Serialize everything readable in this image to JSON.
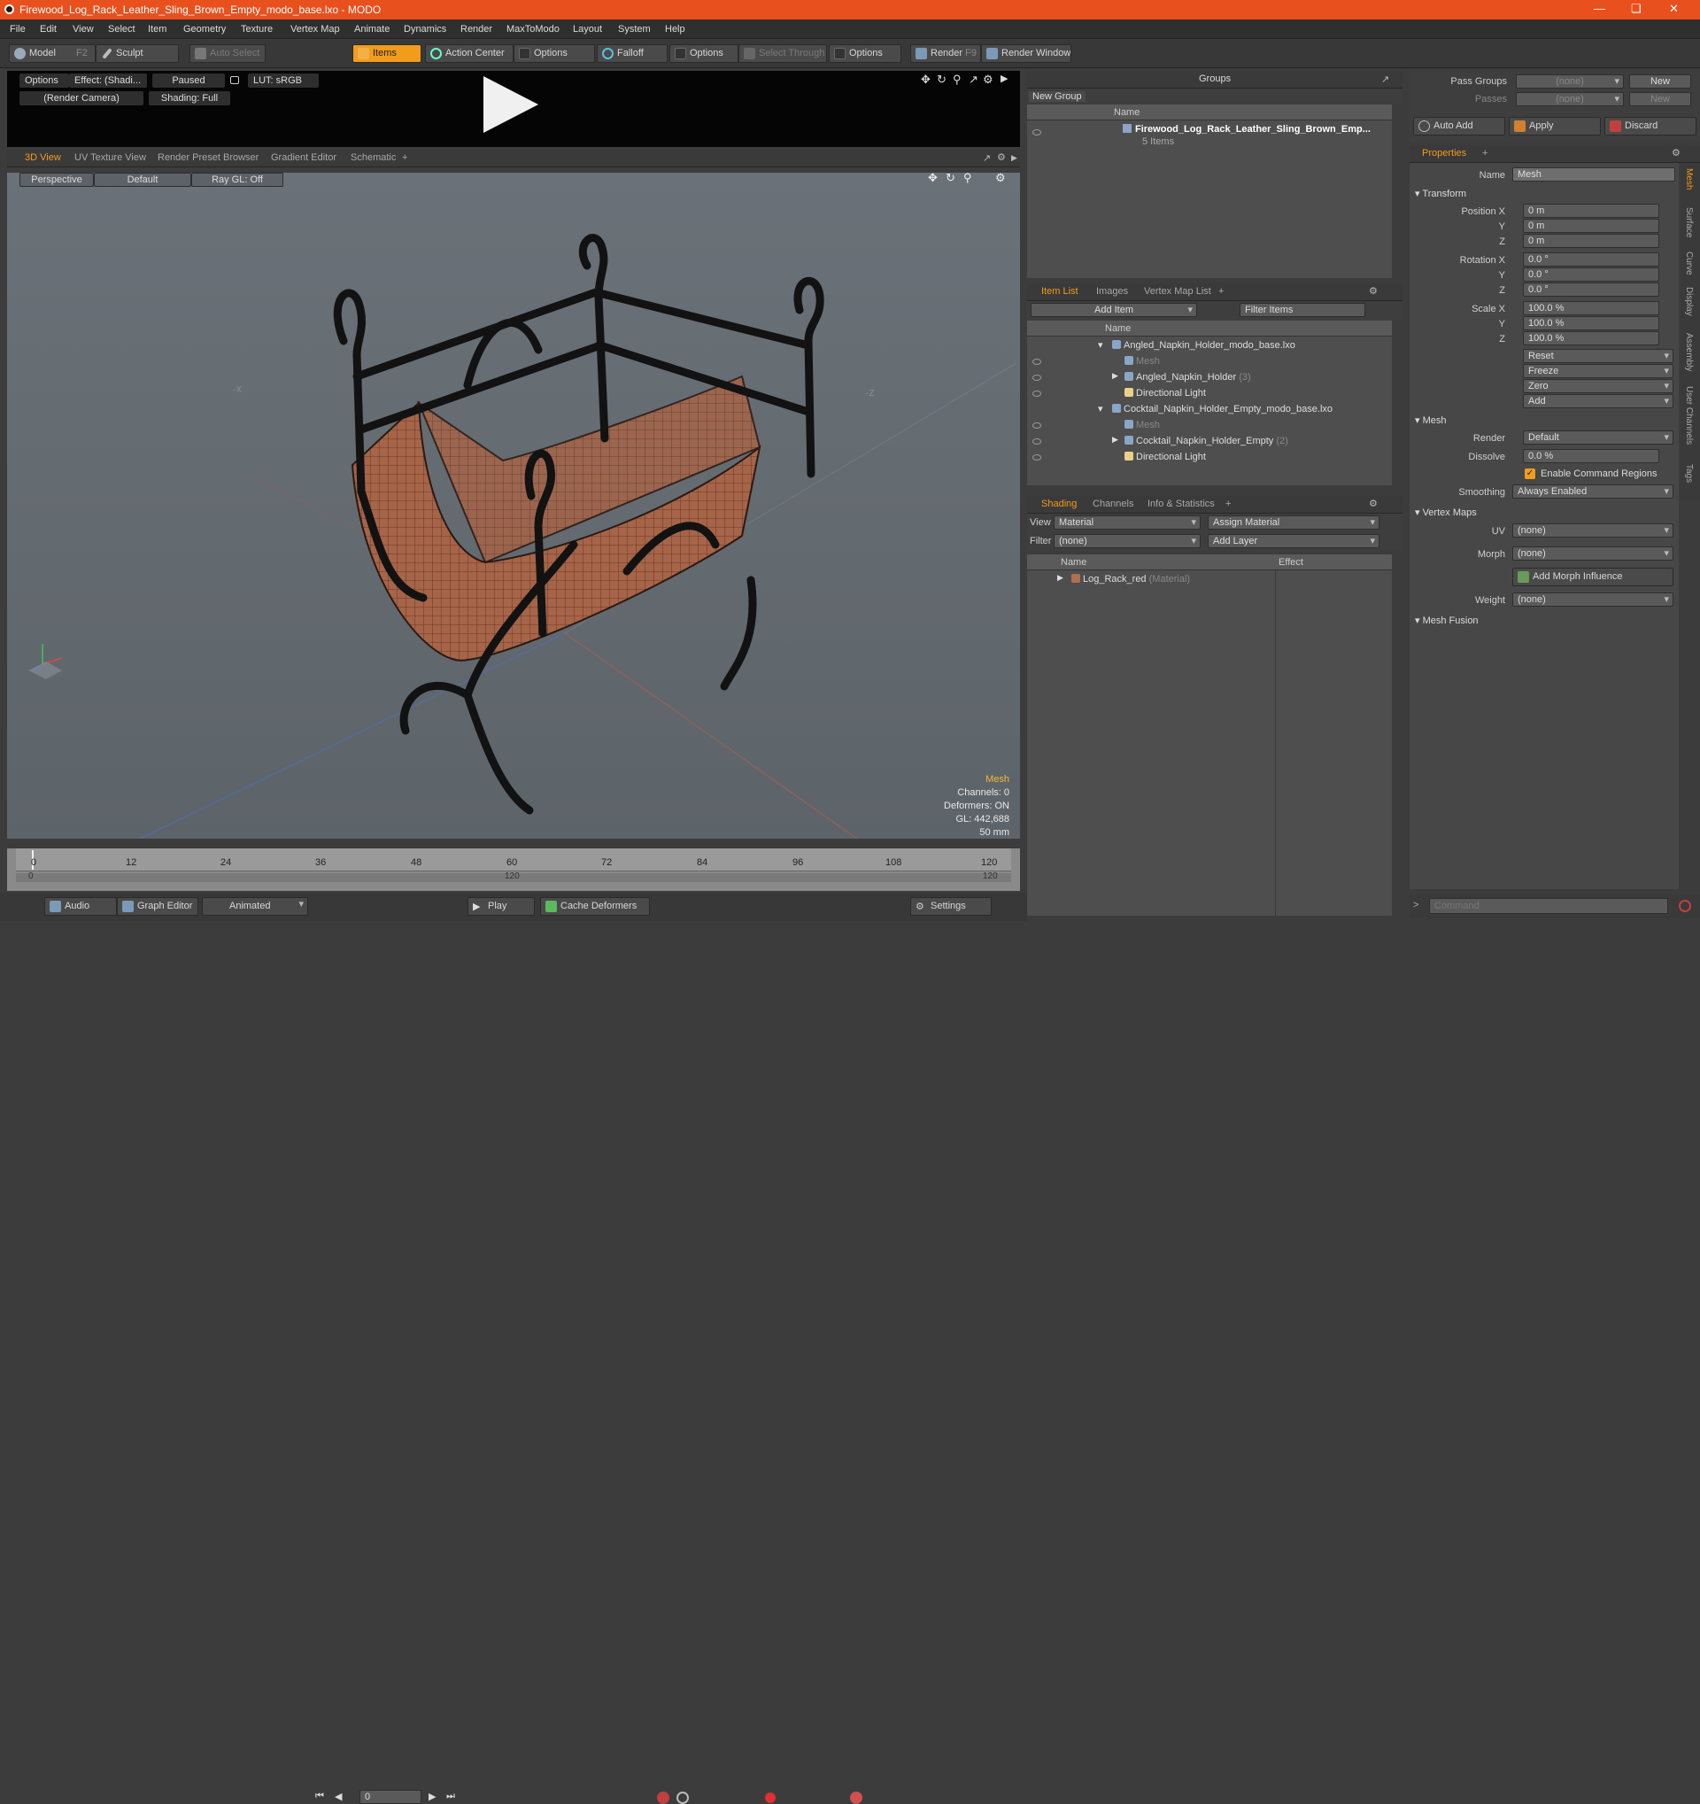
{
  "window": {
    "title": "Firewood_Log_Rack_Leather_Sling_Brown_Empty_modo_base.lxo - MODO"
  },
  "menu": [
    "File",
    "Edit",
    "View",
    "Select",
    "Item",
    "Geometry",
    "Texture",
    "Vertex Map",
    "Animate",
    "Dynamics",
    "Render",
    "MaxToModo",
    "Layout",
    "System",
    "Help"
  ],
  "toolbar": {
    "model": "Model",
    "model_key": "F2",
    "sculpt": "Sculpt",
    "auto_select": "Auto Select",
    "items": "Items",
    "action_center": "Action Center",
    "options1": "Options",
    "falloff": "Falloff",
    "options2": "Options",
    "select_through": "Select Through",
    "options3": "Options",
    "render": "Render",
    "render_key": "F9",
    "render_window": "Render Window"
  },
  "preview": {
    "options": "Options",
    "effect": "Effect: (Shadi...",
    "paused": "Paused",
    "lut": "LUT: sRGB",
    "camera": "(Render Camera)",
    "shading": "Shading: Full"
  },
  "viewtabs": [
    "3D View",
    "UV Texture View",
    "Render Preset Browser",
    "Gradient Editor",
    "Schematic",
    "+"
  ],
  "viewport": {
    "perspective": "Perspective",
    "default": "Default",
    "raygl": "Ray GL: Off",
    "info_title": "Mesh",
    "channels": "Channels: 0",
    "deformers": "Deformers: ON",
    "gl": "GL: 442,688",
    "size": "50 mm"
  },
  "timeline": {
    "ticks": [
      "0",
      "12",
      "24",
      "36",
      "48",
      "60",
      "72",
      "84",
      "96",
      "108",
      "120"
    ],
    "sub_ticks": [
      "0",
      "120",
      "120"
    ]
  },
  "bottombar": {
    "audio": "Audio",
    "graph_editor": "Graph Editor",
    "animated": "Animated",
    "frame": "0",
    "play": "Play",
    "cache": "Cache Deformers",
    "settings": "Settings"
  },
  "groups": {
    "title": "Groups",
    "new_group": "New Group",
    "col_name": "Name",
    "item_name": "Firewood_Log_Rack_Leather_Sling_Brown_Emp...",
    "item_sub": "5 Items"
  },
  "itemlist": {
    "tabs": [
      "Item List",
      "Images",
      "Vertex Map List",
      "+"
    ],
    "add_item": "Add Item",
    "filter": "Filter Items",
    "col_name": "Name",
    "rows": [
      {
        "label": "Angled_Napkin_Holder_modo_base.lxo",
        "indent": 0,
        "type": "scene",
        "count": ""
      },
      {
        "label": "Mesh",
        "indent": 2,
        "type": "mesh",
        "count": "",
        "dim": true
      },
      {
        "label": "Angled_Napkin_Holder",
        "indent": 2,
        "type": "mesh",
        "count": "(3)"
      },
      {
        "label": "Directional Light",
        "indent": 2,
        "type": "light",
        "count": ""
      },
      {
        "label": "Cocktail_Napkin_Holder_Empty_modo_base.lxo",
        "indent": 0,
        "type": "scene",
        "count": ""
      },
      {
        "label": "Mesh",
        "indent": 2,
        "type": "mesh",
        "count": "",
        "dim": true
      },
      {
        "label": "Cocktail_Napkin_Holder_Empty",
        "indent": 2,
        "type": "mesh",
        "count": "(2)"
      },
      {
        "label": "Directional Light",
        "indent": 2,
        "type": "light",
        "count": ""
      }
    ]
  },
  "shading": {
    "tabs": [
      "Shading",
      "Channels",
      "Info & Statistics",
      "+"
    ],
    "view_label": "View",
    "view_value": "Material",
    "assign": "Assign Material",
    "filter_label": "Filter",
    "filter_value": "(none)",
    "add_layer": "Add Layer",
    "col_name": "Name",
    "col_effect": "Effect",
    "row_name": "Log_Rack_red",
    "row_type": "(Material)"
  },
  "passes": {
    "pass_groups": "Pass Groups",
    "passes": "Passes",
    "none": "(none)",
    "new": "New",
    "auto_add": "Auto Add",
    "apply": "Apply",
    "discard": "Discard"
  },
  "properties": {
    "tab": "Properties",
    "name_label": "Name",
    "name_value": "Mesh",
    "transform": "Transform",
    "position_label": "Position X",
    "pos": [
      "0 m",
      "0 m",
      "0 m"
    ],
    "rotation_label": "Rotation X",
    "rot": [
      "0.0 °",
      "0.0 °",
      "0.0 °"
    ],
    "scale_label": "Scale X",
    "scl": [
      "100.0 %",
      "100.0 %",
      "100.0 %"
    ],
    "y": "Y",
    "z": "Z",
    "reset": "Reset",
    "freeze": "Freeze",
    "zero": "Zero",
    "add": "Add",
    "mesh": "Mesh",
    "render_label": "Render",
    "render_value": "Default",
    "dissolve_label": "Dissolve",
    "dissolve_value": "0.0 %",
    "cmd_regions": "Enable Command Regions",
    "smoothing_label": "Smoothing",
    "smoothing_value": "Always Enabled",
    "vertex_maps": "Vertex Maps",
    "uv_label": "UV",
    "uv_value": "(none)",
    "morph_label": "Morph",
    "morph_value": "(none)",
    "add_morph": "Add Morph Influence",
    "weight_label": "Weight",
    "weight_value": "(none)",
    "mesh_fusion": "Mesh Fusion",
    "side_tabs": [
      "Mesh",
      "Surface",
      "Curve",
      "Display",
      "Assembly",
      "User Channels",
      "Tags"
    ]
  },
  "command": {
    "placeholder": "Command"
  }
}
